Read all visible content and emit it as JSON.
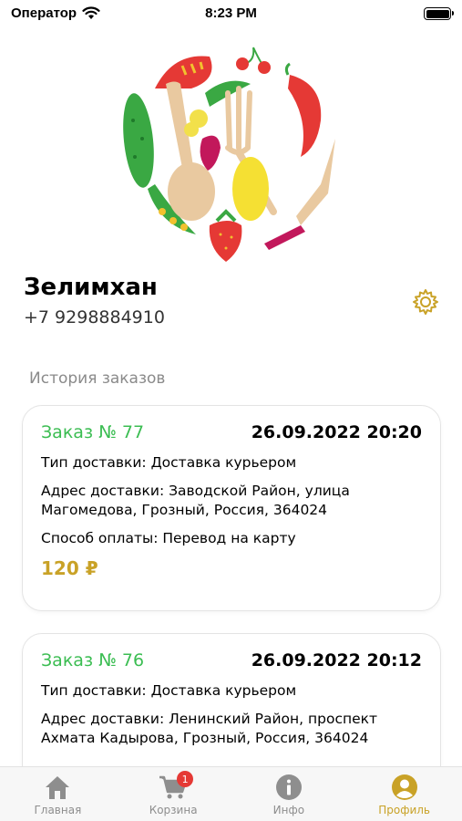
{
  "status_bar": {
    "carrier": "Оператор",
    "time": "8:23 PM"
  },
  "profile": {
    "name": "Зелимхан",
    "phone": "+7 9298884910"
  },
  "orders_section": {
    "title": "История заказов"
  },
  "orders": [
    {
      "number": "Заказ № 77",
      "date": "26.09.2022 20:20",
      "delivery_type": "Тип доставки: Доставка курьером",
      "address": "Адрес доставки: Заводской Район, улица Магомедова, Грозный, Россия, 364024",
      "payment": "Способ оплаты: Перевод на карту",
      "price": "120 ₽"
    },
    {
      "number": "Заказ № 76",
      "date": "26.09.2022 20:12",
      "delivery_type": "Тип доставки: Доставка курьером",
      "address": "Адрес доставки: Ленинский Район, проспект Ахмата Кадырова, Грозный, Россия, 364024"
    }
  ],
  "tabbar": {
    "tabs": [
      {
        "label": "Главная",
        "icon": "home-icon"
      },
      {
        "label": "Корзина",
        "icon": "cart-icon",
        "badge": "1"
      },
      {
        "label": "Инфо",
        "icon": "info-icon"
      },
      {
        "label": "Профиль",
        "icon": "profile-icon"
      }
    ],
    "active_tab": "Профиль"
  },
  "colors": {
    "accent": "#c9a227",
    "order_number": "#3bbd52",
    "badge": "#e53935"
  }
}
